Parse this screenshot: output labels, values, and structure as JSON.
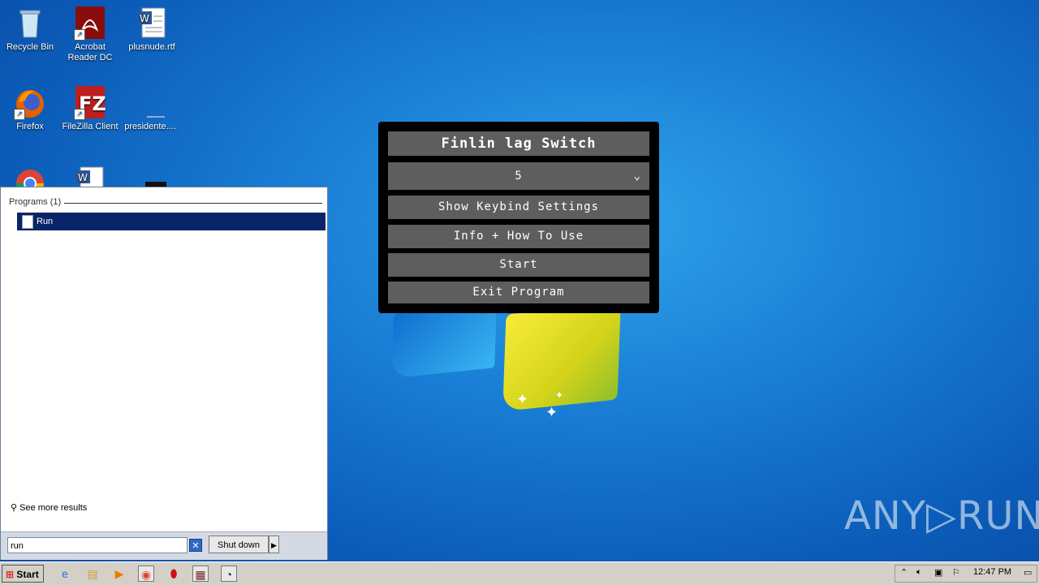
{
  "desktop": {
    "icons": [
      {
        "label": "Recycle Bin"
      },
      {
        "label": "Acrobat Reader DC"
      },
      {
        "label": "plusnude.rtf"
      },
      {
        "label": "Firefox"
      },
      {
        "label": "FileZilla Client"
      },
      {
        "label": "presidente...."
      }
    ],
    "watermark": "ANY▷RUN"
  },
  "lag_window": {
    "title": "Finlin lag Switch",
    "selected_value": "5",
    "buttons": [
      "Show Keybind Settings",
      "Info + How To Use",
      "Start",
      "Exit Program"
    ]
  },
  "start_menu": {
    "group_header": "Programs (1)",
    "results": [
      {
        "label": "Run"
      }
    ],
    "see_more": "See more results",
    "search_value": "run",
    "shutdown_label": "Shut down"
  },
  "taskbar": {
    "start_label": "Start",
    "clock": "12:47 PM"
  }
}
